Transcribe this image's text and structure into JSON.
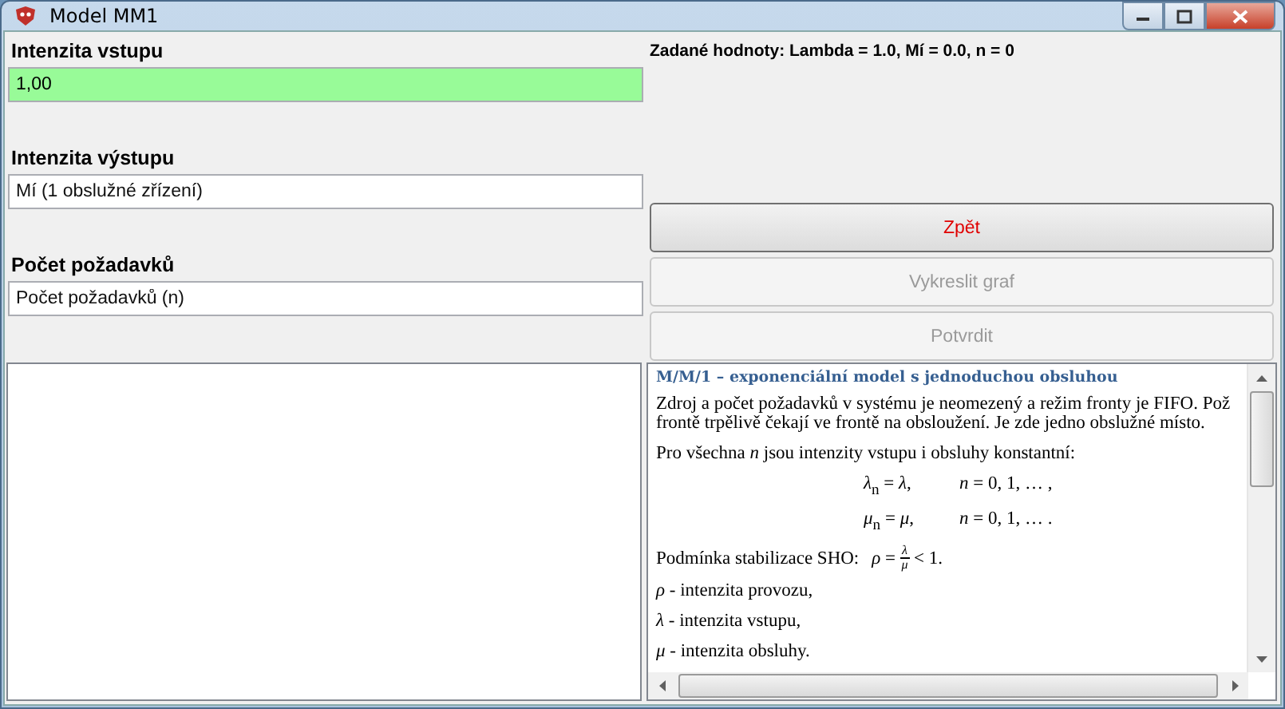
{
  "window": {
    "title": "Model MM1"
  },
  "info": "Zadané hodnoty: Lambda = 1.0, Mí = 0.0, n = 0",
  "fields": [
    {
      "label": "Intenzita vstupu",
      "value": "1,00",
      "highlighted": true
    },
    {
      "label": "Intenzita výstupu",
      "placeholder": "Mí (1 obslužné zřízení)",
      "highlighted": false
    },
    {
      "label": "Počet požadavků",
      "placeholder": "Počet požadavků (n)",
      "highlighted": false
    }
  ],
  "buttons": [
    {
      "label": "Zpět",
      "disabled": false
    },
    {
      "label": "Vykreslit graf",
      "disabled": true
    },
    {
      "label": "Potvrdit",
      "disabled": true
    }
  ],
  "document": {
    "heading": "M/M/1 – exponenciální model s jednoduchou obsluhou",
    "blocks": [
      {
        "kind": "text",
        "lines": [
          "Zdroj a počet požadavků v systému je neomezený a režim fronty je FIFO. Pož",
          "frontě trpělivě čekají ve frontě na obsloužení. Je zde jedno obslužné místo."
        ]
      },
      {
        "kind": "text",
        "lines": [
          "Pro všechna *n* jsou intenzity vstupu i obsluhy konstantní:"
        ]
      },
      {
        "kind": "equation",
        "left": "*λ*$_{n}$ = *λ*,",
        "right": "*n* = 0, 1, … ,"
      },
      {
        "kind": "equation",
        "left": "*μ*$_{n}$ = *μ*,",
        "right": "*n* = 0, 1, … ."
      },
      {
        "kind": "fraction",
        "prefix": "Podmínka stabilizace SHO:",
        "lhs": "*ρ* =",
        "num": "*λ*",
        "den": "*μ*",
        "rhs": "< 1."
      },
      {
        "kind": "text",
        "lines": [
          "*ρ* - intenzita provozu,"
        ]
      },
      {
        "kind": "text",
        "lines": [
          "*λ* - intenzita vstupu,"
        ]
      },
      {
        "kind": "text",
        "lines": [
          "*μ* - intenzita obsluhy."
        ]
      }
    ]
  }
}
